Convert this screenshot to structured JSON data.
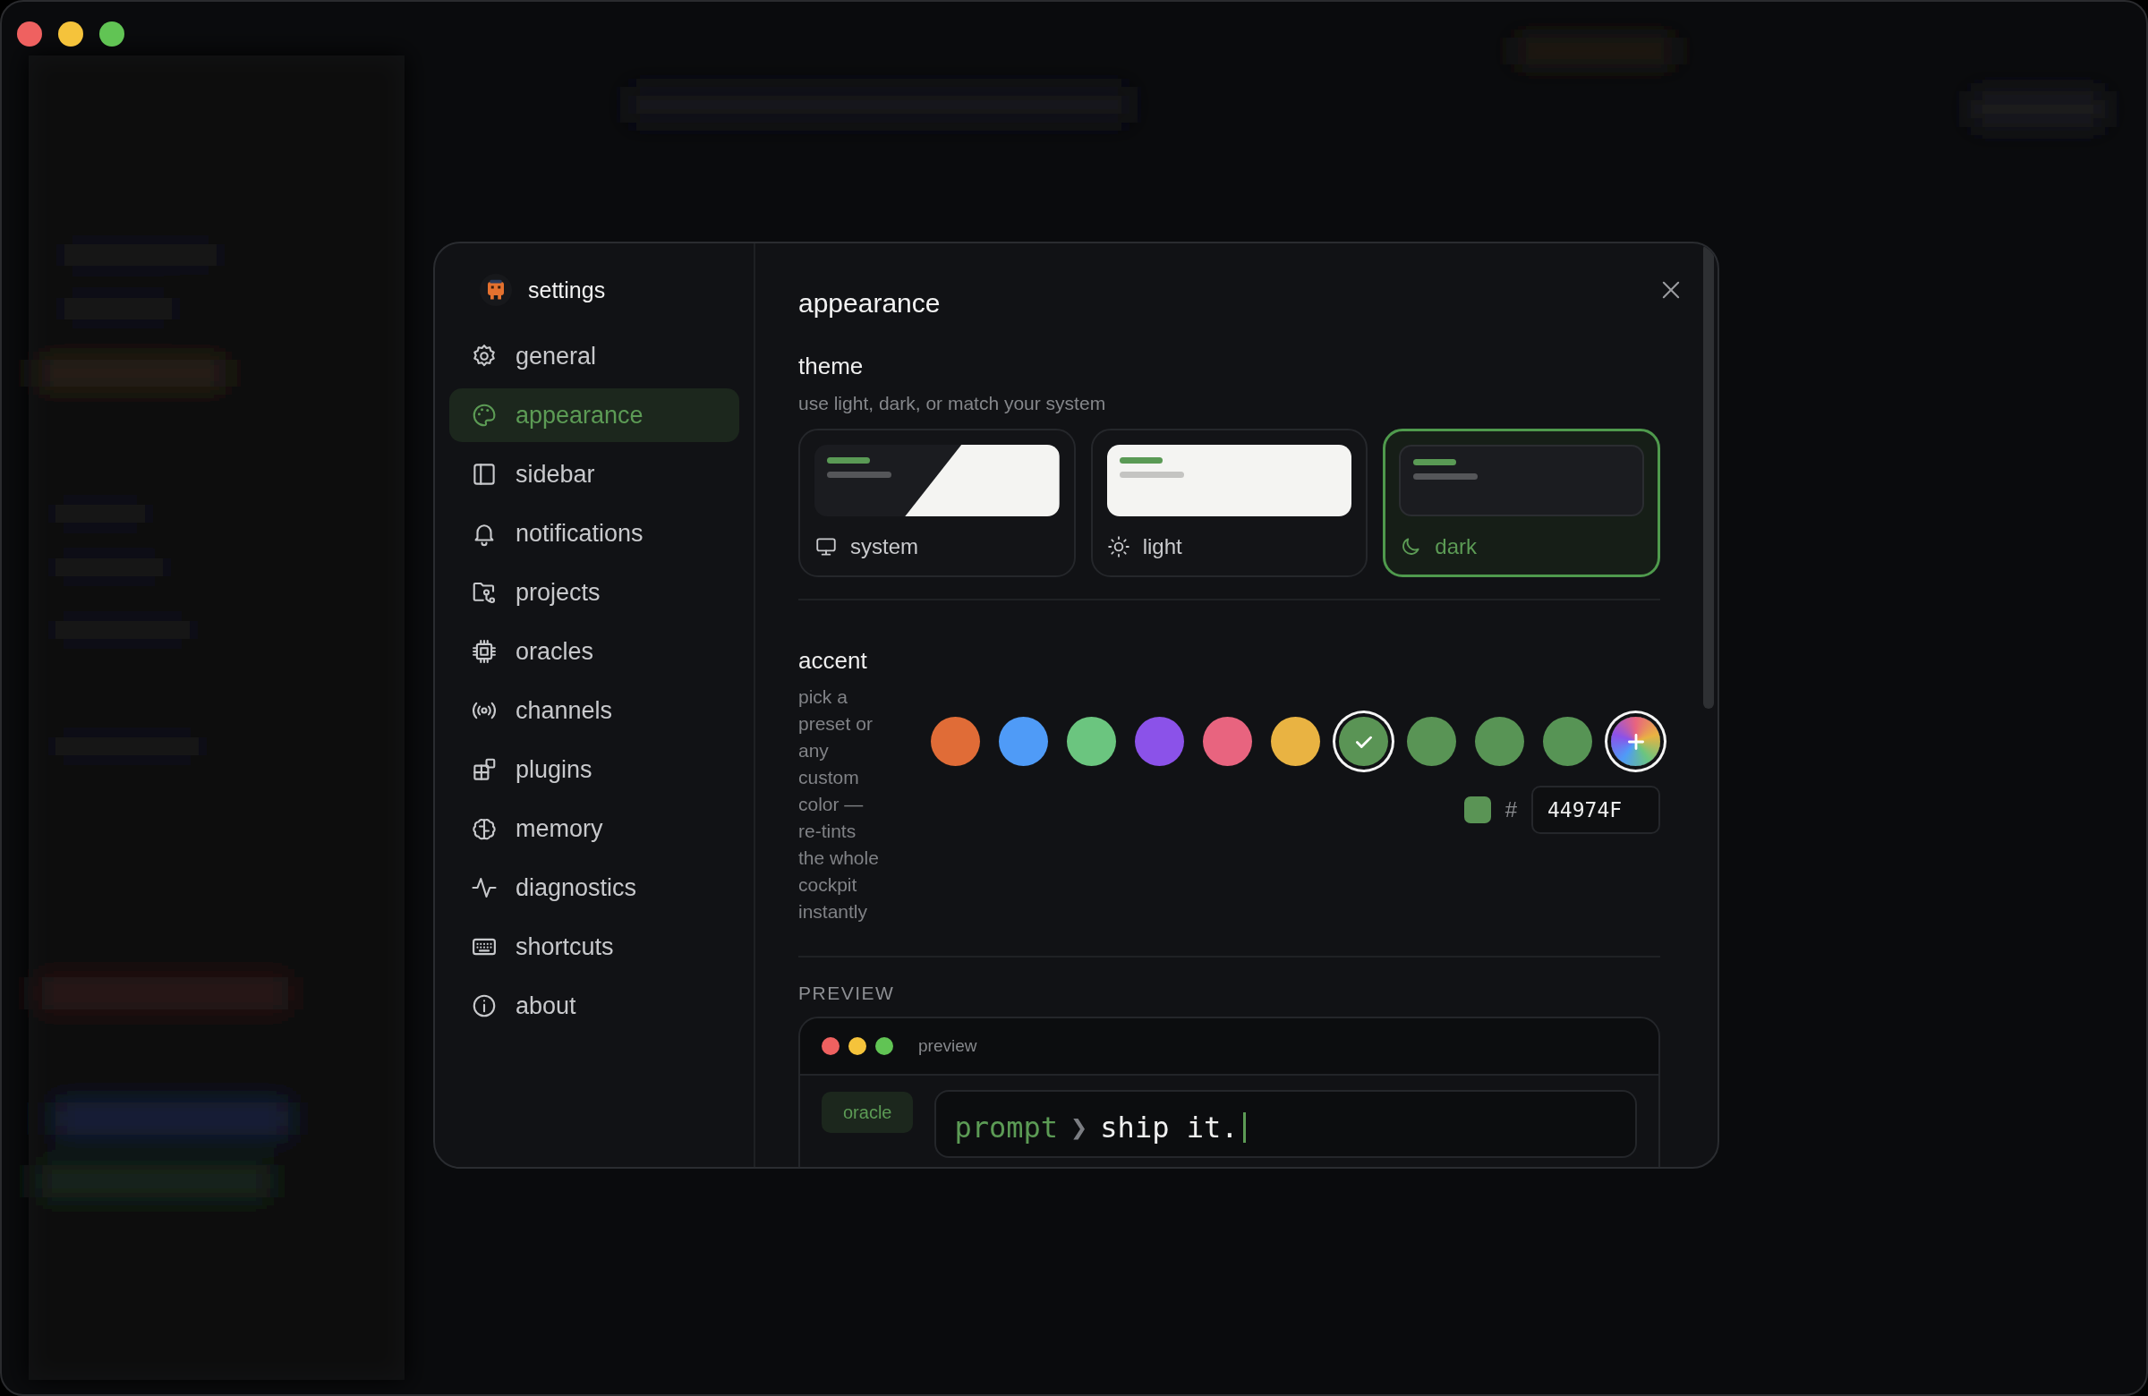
{
  "settings": {
    "title": "settings",
    "nav": {
      "items": [
        {
          "label": "general",
          "selected": false
        },
        {
          "label": "appearance",
          "selected": true
        },
        {
          "label": "sidebar",
          "selected": false
        },
        {
          "label": "notifications",
          "selected": false
        },
        {
          "label": "projects",
          "selected": false
        },
        {
          "label": "oracles",
          "selected": false
        },
        {
          "label": "channels",
          "selected": false
        },
        {
          "label": "plugins",
          "selected": false
        },
        {
          "label": "memory",
          "selected": false
        },
        {
          "label": "diagnostics",
          "selected": false
        },
        {
          "label": "shortcuts",
          "selected": false
        },
        {
          "label": "about",
          "selected": false
        }
      ]
    },
    "page_title": "appearance",
    "theme": {
      "label": "theme",
      "description": "use light, dark, or match your system",
      "options": [
        {
          "kind": "system",
          "label": "system",
          "selected": false
        },
        {
          "kind": "light",
          "label": "light",
          "selected": false
        },
        {
          "kind": "dark",
          "label": "dark",
          "selected": true
        }
      ]
    },
    "accent": {
      "label": "accent",
      "description": "pick a preset or any custom color — re-tints the whole cockpit instantly",
      "swatches": [
        {
          "kind": "preset",
          "color": "#e06c37",
          "selected": false
        },
        {
          "kind": "preset",
          "color": "#4f9bf7",
          "selected": false
        },
        {
          "kind": "preset",
          "color": "#6bc57f",
          "selected": false
        },
        {
          "kind": "preset",
          "color": "#8b52e9",
          "selected": false
        },
        {
          "kind": "preset",
          "color": "#e8647f",
          "selected": false
        },
        {
          "kind": "preset",
          "color": "#e9b342",
          "selected": false
        },
        {
          "kind": "preset",
          "color": "#5a9455",
          "selected": true
        },
        {
          "kind": "preset",
          "color": "#599455",
          "selected": false
        },
        {
          "kind": "preset",
          "color": "#589455",
          "selected": false
        },
        {
          "kind": "preset",
          "color": "#579455",
          "selected": false
        },
        {
          "kind": "custom",
          "selected": false
        }
      ],
      "hex_prefix": "#",
      "hex_value": "44974F"
    },
    "preview": {
      "heading": "PREVIEW",
      "title": "preview",
      "badge": "oracle",
      "prompt_label": "prompt",
      "prompt_symbol": "❯",
      "input": "ship it."
    }
  }
}
